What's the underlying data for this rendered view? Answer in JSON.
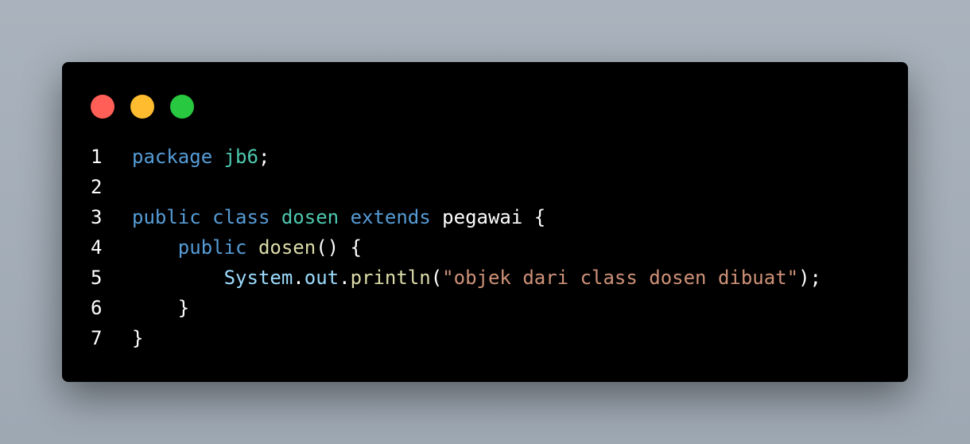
{
  "window": {
    "controls": [
      {
        "name": "close",
        "color": "#ff5f57"
      },
      {
        "name": "minimize",
        "color": "#febc2e"
      },
      {
        "name": "maximize",
        "color": "#28c840"
      }
    ]
  },
  "colors": {
    "keyword": "#569cd6",
    "type": "#4ec9b0",
    "plain": "#ffffff",
    "method": "#dcdcaa",
    "identifier": "#9cdcfe",
    "string": "#ce9178",
    "line_number": "#ffffff"
  },
  "code": {
    "language": "java",
    "lines": [
      {
        "number": "1",
        "tokens": [
          {
            "text": "package",
            "kind": "keyword"
          },
          {
            "text": " ",
            "kind": "plain"
          },
          {
            "text": "jb6",
            "kind": "type"
          },
          {
            "text": ";",
            "kind": "plain"
          }
        ]
      },
      {
        "number": "2",
        "tokens": []
      },
      {
        "number": "3",
        "tokens": [
          {
            "text": "public",
            "kind": "keyword"
          },
          {
            "text": " ",
            "kind": "plain"
          },
          {
            "text": "class",
            "kind": "keyword"
          },
          {
            "text": " ",
            "kind": "plain"
          },
          {
            "text": "dosen",
            "kind": "type"
          },
          {
            "text": " ",
            "kind": "plain"
          },
          {
            "text": "extends",
            "kind": "keyword"
          },
          {
            "text": " pegawai {",
            "kind": "plain"
          }
        ]
      },
      {
        "number": "4",
        "tokens": [
          {
            "text": "    ",
            "kind": "plain"
          },
          {
            "text": "public",
            "kind": "keyword"
          },
          {
            "text": " ",
            "kind": "plain"
          },
          {
            "text": "dosen",
            "kind": "method"
          },
          {
            "text": "() {",
            "kind": "plain"
          }
        ]
      },
      {
        "number": "5",
        "tokens": [
          {
            "text": "        ",
            "kind": "plain"
          },
          {
            "text": "System",
            "kind": "identifier"
          },
          {
            "text": ".",
            "kind": "plain"
          },
          {
            "text": "out",
            "kind": "identifier"
          },
          {
            "text": ".",
            "kind": "plain"
          },
          {
            "text": "println",
            "kind": "method"
          },
          {
            "text": "(",
            "kind": "plain"
          },
          {
            "text": "\"objek dari class dosen dibuat\"",
            "kind": "string"
          },
          {
            "text": ");",
            "kind": "plain"
          }
        ]
      },
      {
        "number": "6",
        "tokens": [
          {
            "text": "    }",
            "kind": "plain"
          }
        ]
      },
      {
        "number": "7",
        "tokens": [
          {
            "text": "}",
            "kind": "plain"
          }
        ]
      }
    ]
  }
}
